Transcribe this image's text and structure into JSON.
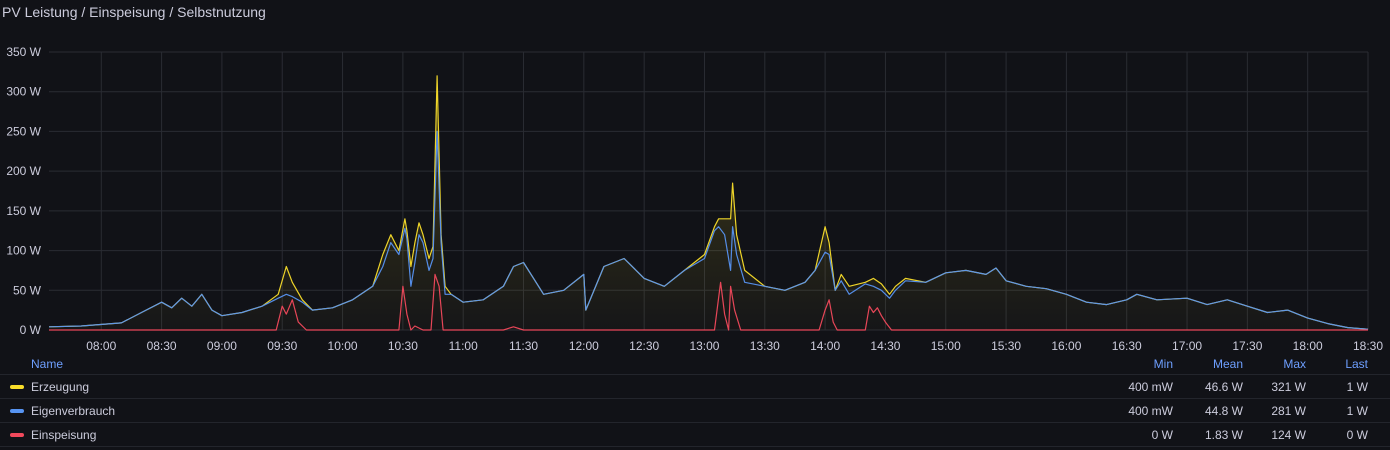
{
  "panel": {
    "title": "PV Leistung / Einspeisung / Selbstnutzung"
  },
  "legend": {
    "headers": {
      "name": "Name",
      "min": "Min",
      "mean": "Mean",
      "max": "Max",
      "last": "Last"
    },
    "rows": [
      {
        "name": "Erzeugung",
        "color": "#fade2a",
        "min": "400 mW",
        "mean": "46.6 W",
        "max": "321 W",
        "last": "1 W"
      },
      {
        "name": "Eigenverbrauch",
        "color": "#5794f2",
        "min": "400 mW",
        "mean": "44.8 W",
        "max": "281 W",
        "last": "1 W"
      },
      {
        "name": "Einspeisung",
        "color": "#f2495c",
        "min": "0 W",
        "mean": "1.83 W",
        "max": "124 W",
        "last": "0 W"
      }
    ]
  },
  "chart_data": {
    "type": "line",
    "xlabel": "",
    "ylabel": "",
    "ylim": [
      0,
      350
    ],
    "xlim": [
      "07:34",
      "18:30"
    ],
    "yticks": [
      "0 W",
      "50 W",
      "100 W",
      "150 W",
      "200 W",
      "250 W",
      "300 W",
      "350 W"
    ],
    "xticks": [
      "08:00",
      "08:30",
      "09:00",
      "09:30",
      "10:00",
      "10:30",
      "11:00",
      "11:30",
      "12:00",
      "12:30",
      "13:00",
      "13:30",
      "14:00",
      "14:30",
      "15:00",
      "15:30",
      "16:00",
      "16:30",
      "17:00",
      "17:30",
      "18:00",
      "18:30"
    ],
    "grid": true,
    "legend_position": "bottom",
    "series": [
      {
        "name": "Erzeugung",
        "color": "#fade2a",
        "x": [
          "07:34",
          "07:50",
          "08:10",
          "08:20",
          "08:30",
          "08:35",
          "08:40",
          "08:45",
          "08:50",
          "08:55",
          "09:00",
          "09:10",
          "09:20",
          "09:28",
          "09:32",
          "09:35",
          "09:40",
          "09:45",
          "09:55",
          "10:05",
          "10:15",
          "10:20",
          "10:24",
          "10:28",
          "10:31",
          "10:32",
          "10:34",
          "10:36",
          "10:38",
          "10:40",
          "10:43",
          "10:45",
          "10:47",
          "10:49",
          "10:51",
          "10:54",
          "11:00",
          "11:10",
          "11:20",
          "11:25",
          "11:30",
          "11:35",
          "11:40",
          "11:50",
          "12:00",
          "12:01",
          "12:10",
          "12:20",
          "12:30",
          "12:40",
          "12:50",
          "13:00",
          "13:05",
          "13:07",
          "13:10",
          "13:13",
          "13:14",
          "13:16",
          "13:20",
          "13:30",
          "13:40",
          "13:50",
          "13:55",
          "14:00",
          "14:02",
          "14:05",
          "14:08",
          "14:12",
          "14:20",
          "14:24",
          "14:28",
          "14:32",
          "14:35",
          "14:40",
          "14:50",
          "15:00",
          "15:10",
          "15:20",
          "15:25",
          "15:30",
          "15:40",
          "15:50",
          "16:00",
          "16:10",
          "16:20",
          "16:30",
          "16:35",
          "16:45",
          "17:00",
          "17:10",
          "17:20",
          "17:30",
          "17:40",
          "17:50",
          "18:00",
          "18:10",
          "18:20",
          "18:30"
        ],
        "values": [
          4,
          5,
          9,
          22,
          35,
          28,
          40,
          30,
          45,
          25,
          18,
          22,
          30,
          45,
          80,
          60,
          38,
          25,
          28,
          38,
          55,
          95,
          120,
          100,
          140,
          125,
          80,
          110,
          135,
          120,
          90,
          105,
          320,
          120,
          55,
          45,
          35,
          38,
          55,
          80,
          85,
          65,
          45,
          50,
          70,
          25,
          80,
          90,
          65,
          55,
          75,
          95,
          130,
          140,
          140,
          140,
          185,
          120,
          75,
          55,
          50,
          60,
          75,
          130,
          110,
          50,
          70,
          55,
          60,
          65,
          58,
          45,
          55,
          65,
          60,
          72,
          75,
          70,
          78,
          62,
          55,
          52,
          45,
          35,
          32,
          38,
          45,
          38,
          40,
          32,
          38,
          30,
          22,
          25,
          15,
          8,
          3,
          1
        ]
      },
      {
        "name": "Eigenverbrauch",
        "color": "#5794f2",
        "x": [
          "07:34",
          "07:50",
          "08:10",
          "08:20",
          "08:30",
          "08:35",
          "08:40",
          "08:45",
          "08:50",
          "08:55",
          "09:00",
          "09:10",
          "09:20",
          "09:28",
          "09:32",
          "09:35",
          "09:40",
          "09:45",
          "09:55",
          "10:05",
          "10:15",
          "10:20",
          "10:24",
          "10:28",
          "10:31",
          "10:32",
          "10:34",
          "10:36",
          "10:38",
          "10:40",
          "10:43",
          "10:45",
          "10:47",
          "10:49",
          "10:51",
          "10:54",
          "11:00",
          "11:10",
          "11:20",
          "11:25",
          "11:30",
          "11:35",
          "11:40",
          "11:50",
          "12:00",
          "12:01",
          "12:10",
          "12:20",
          "12:30",
          "12:40",
          "12:50",
          "13:00",
          "13:05",
          "13:07",
          "13:10",
          "13:13",
          "13:14",
          "13:16",
          "13:20",
          "13:30",
          "13:40",
          "13:50",
          "13:55",
          "14:00",
          "14:02",
          "14:05",
          "14:08",
          "14:12",
          "14:20",
          "14:24",
          "14:28",
          "14:32",
          "14:35",
          "14:40",
          "14:50",
          "15:00",
          "15:10",
          "15:20",
          "15:25",
          "15:30",
          "15:40",
          "15:50",
          "16:00",
          "16:10",
          "16:20",
          "16:30",
          "16:35",
          "16:45",
          "17:00",
          "17:10",
          "17:20",
          "17:30",
          "17:40",
          "17:50",
          "18:00",
          "18:10",
          "18:20",
          "18:30"
        ],
        "values": [
          4,
          5,
          9,
          22,
          35,
          28,
          40,
          30,
          45,
          25,
          18,
          22,
          30,
          40,
          45,
          42,
          35,
          25,
          28,
          38,
          55,
          80,
          110,
          95,
          128,
          115,
          55,
          85,
          120,
          110,
          75,
          90,
          250,
          110,
          45,
          45,
          35,
          38,
          55,
          80,
          85,
          65,
          45,
          50,
          70,
          25,
          80,
          90,
          65,
          55,
          75,
          90,
          125,
          130,
          120,
          75,
          130,
          95,
          60,
          55,
          50,
          60,
          75,
          98,
          95,
          50,
          62,
          45,
          58,
          55,
          50,
          40,
          50,
          62,
          60,
          72,
          75,
          70,
          78,
          62,
          55,
          52,
          45,
          35,
          32,
          38,
          45,
          38,
          40,
          32,
          38,
          30,
          22,
          25,
          15,
          8,
          3,
          1
        ]
      },
      {
        "name": "Einspeisung",
        "color": "#f2495c",
        "x": [
          "07:34",
          "09:27",
          "09:30",
          "09:32",
          "09:35",
          "09:38",
          "09:42",
          "10:28",
          "10:30",
          "10:32",
          "10:34",
          "10:36",
          "10:40",
          "10:44",
          "10:46",
          "10:48",
          "10:50",
          "10:53",
          "11:20",
          "11:25",
          "11:30",
          "13:05",
          "13:08",
          "13:10",
          "13:12",
          "13:13",
          "13:15",
          "13:18",
          "13:45",
          "13:57",
          "14:00",
          "14:02",
          "14:04",
          "14:06",
          "14:20",
          "14:22",
          "14:24",
          "14:26",
          "14:28",
          "14:30",
          "14:33",
          "18:30"
        ],
        "values": [
          0,
          0,
          30,
          20,
          38,
          10,
          0,
          0,
          55,
          20,
          0,
          5,
          0,
          0,
          70,
          55,
          0,
          0,
          0,
          4,
          0,
          0,
          60,
          20,
          0,
          55,
          25,
          0,
          0,
          0,
          25,
          38,
          10,
          0,
          0,
          30,
          22,
          28,
          18,
          10,
          0,
          0
        ]
      }
    ]
  }
}
